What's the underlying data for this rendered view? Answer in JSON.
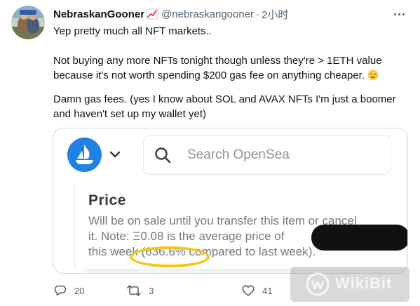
{
  "tweet": {
    "display_name": "NebraskanGooner",
    "name_emoji": "chart-increasing-emoji",
    "handle": "@nebraskangooner",
    "separator": "·",
    "time": "2小时",
    "text": {
      "p1": "Yep pretty much all NFT markets..",
      "p2_line1": "Not buying any more NFTs tonight though unless they're > 1ETH value",
      "p2_line2": "because it's not worth spending $200 gas fee on anything cheaper.",
      "p2_emoji": "expressionless-face-emoji",
      "p3_line1": "Damn gas fees. (yes I know about SOL and AVAX NFTs I'm just a boomer",
      "p3_line2": "and haven't set up my wallet yet)"
    }
  },
  "media": {
    "search_placeholder": "Search OpenSea",
    "price_title": "Price",
    "price_line1": "Will be on sale until you transfer this item or cancel",
    "price_line2": "it. Note: Ξ0.08 is the average price of",
    "price_line3": "this week (636.6% compared to last week).",
    "highlight_color": "#f5c518",
    "opensea_blue": "#2081e2"
  },
  "actions": {
    "reply_count": "20",
    "retweet_count": "3",
    "like_count": "41"
  },
  "watermark": {
    "text": "WikiBit"
  }
}
